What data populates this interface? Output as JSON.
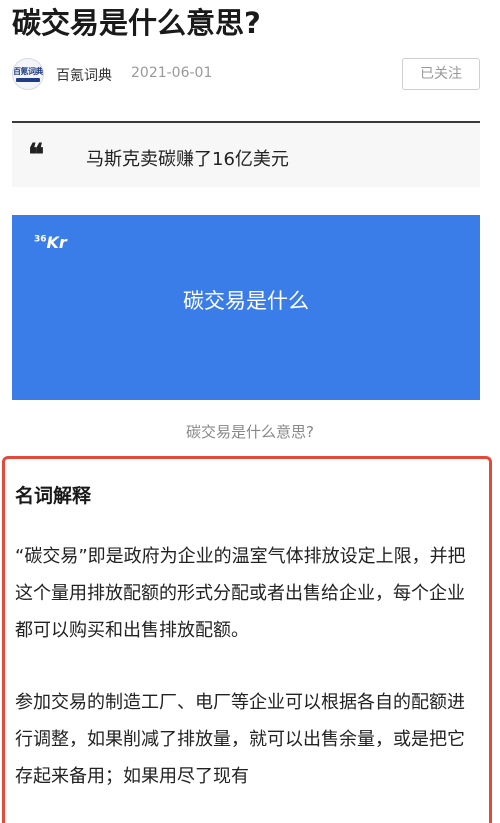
{
  "article": {
    "title": "碳交易是什么意思?",
    "author": "百氪词典",
    "date": "2021-06-01",
    "follow_label": "已关注",
    "avatar_text": "百氪词典"
  },
  "quote": {
    "icon": "❝",
    "text": "马斯克卖碳赚了16亿美元"
  },
  "banner": {
    "logo_main": "Kr",
    "logo_sup": "36",
    "text": "碳交易是什么",
    "background": "#3a7de8"
  },
  "caption": "碳交易是什么意思?",
  "explanation": {
    "heading": "名词解释",
    "paragraph1": "“碳交易”即是政府为企业的温室气体排放设定上限，并把这个量用排放配额的形式分配或者出售给企业，每个企业都可以购买和出售排放配额。",
    "paragraph2": "参加交易的制造工厂、电厂等企业可以根据各自的配额进行调整，如果削减了排放量，就可以出售余量，或是把它存起来备用；如果用尽了现有",
    "border_color": "#e34a3c"
  }
}
